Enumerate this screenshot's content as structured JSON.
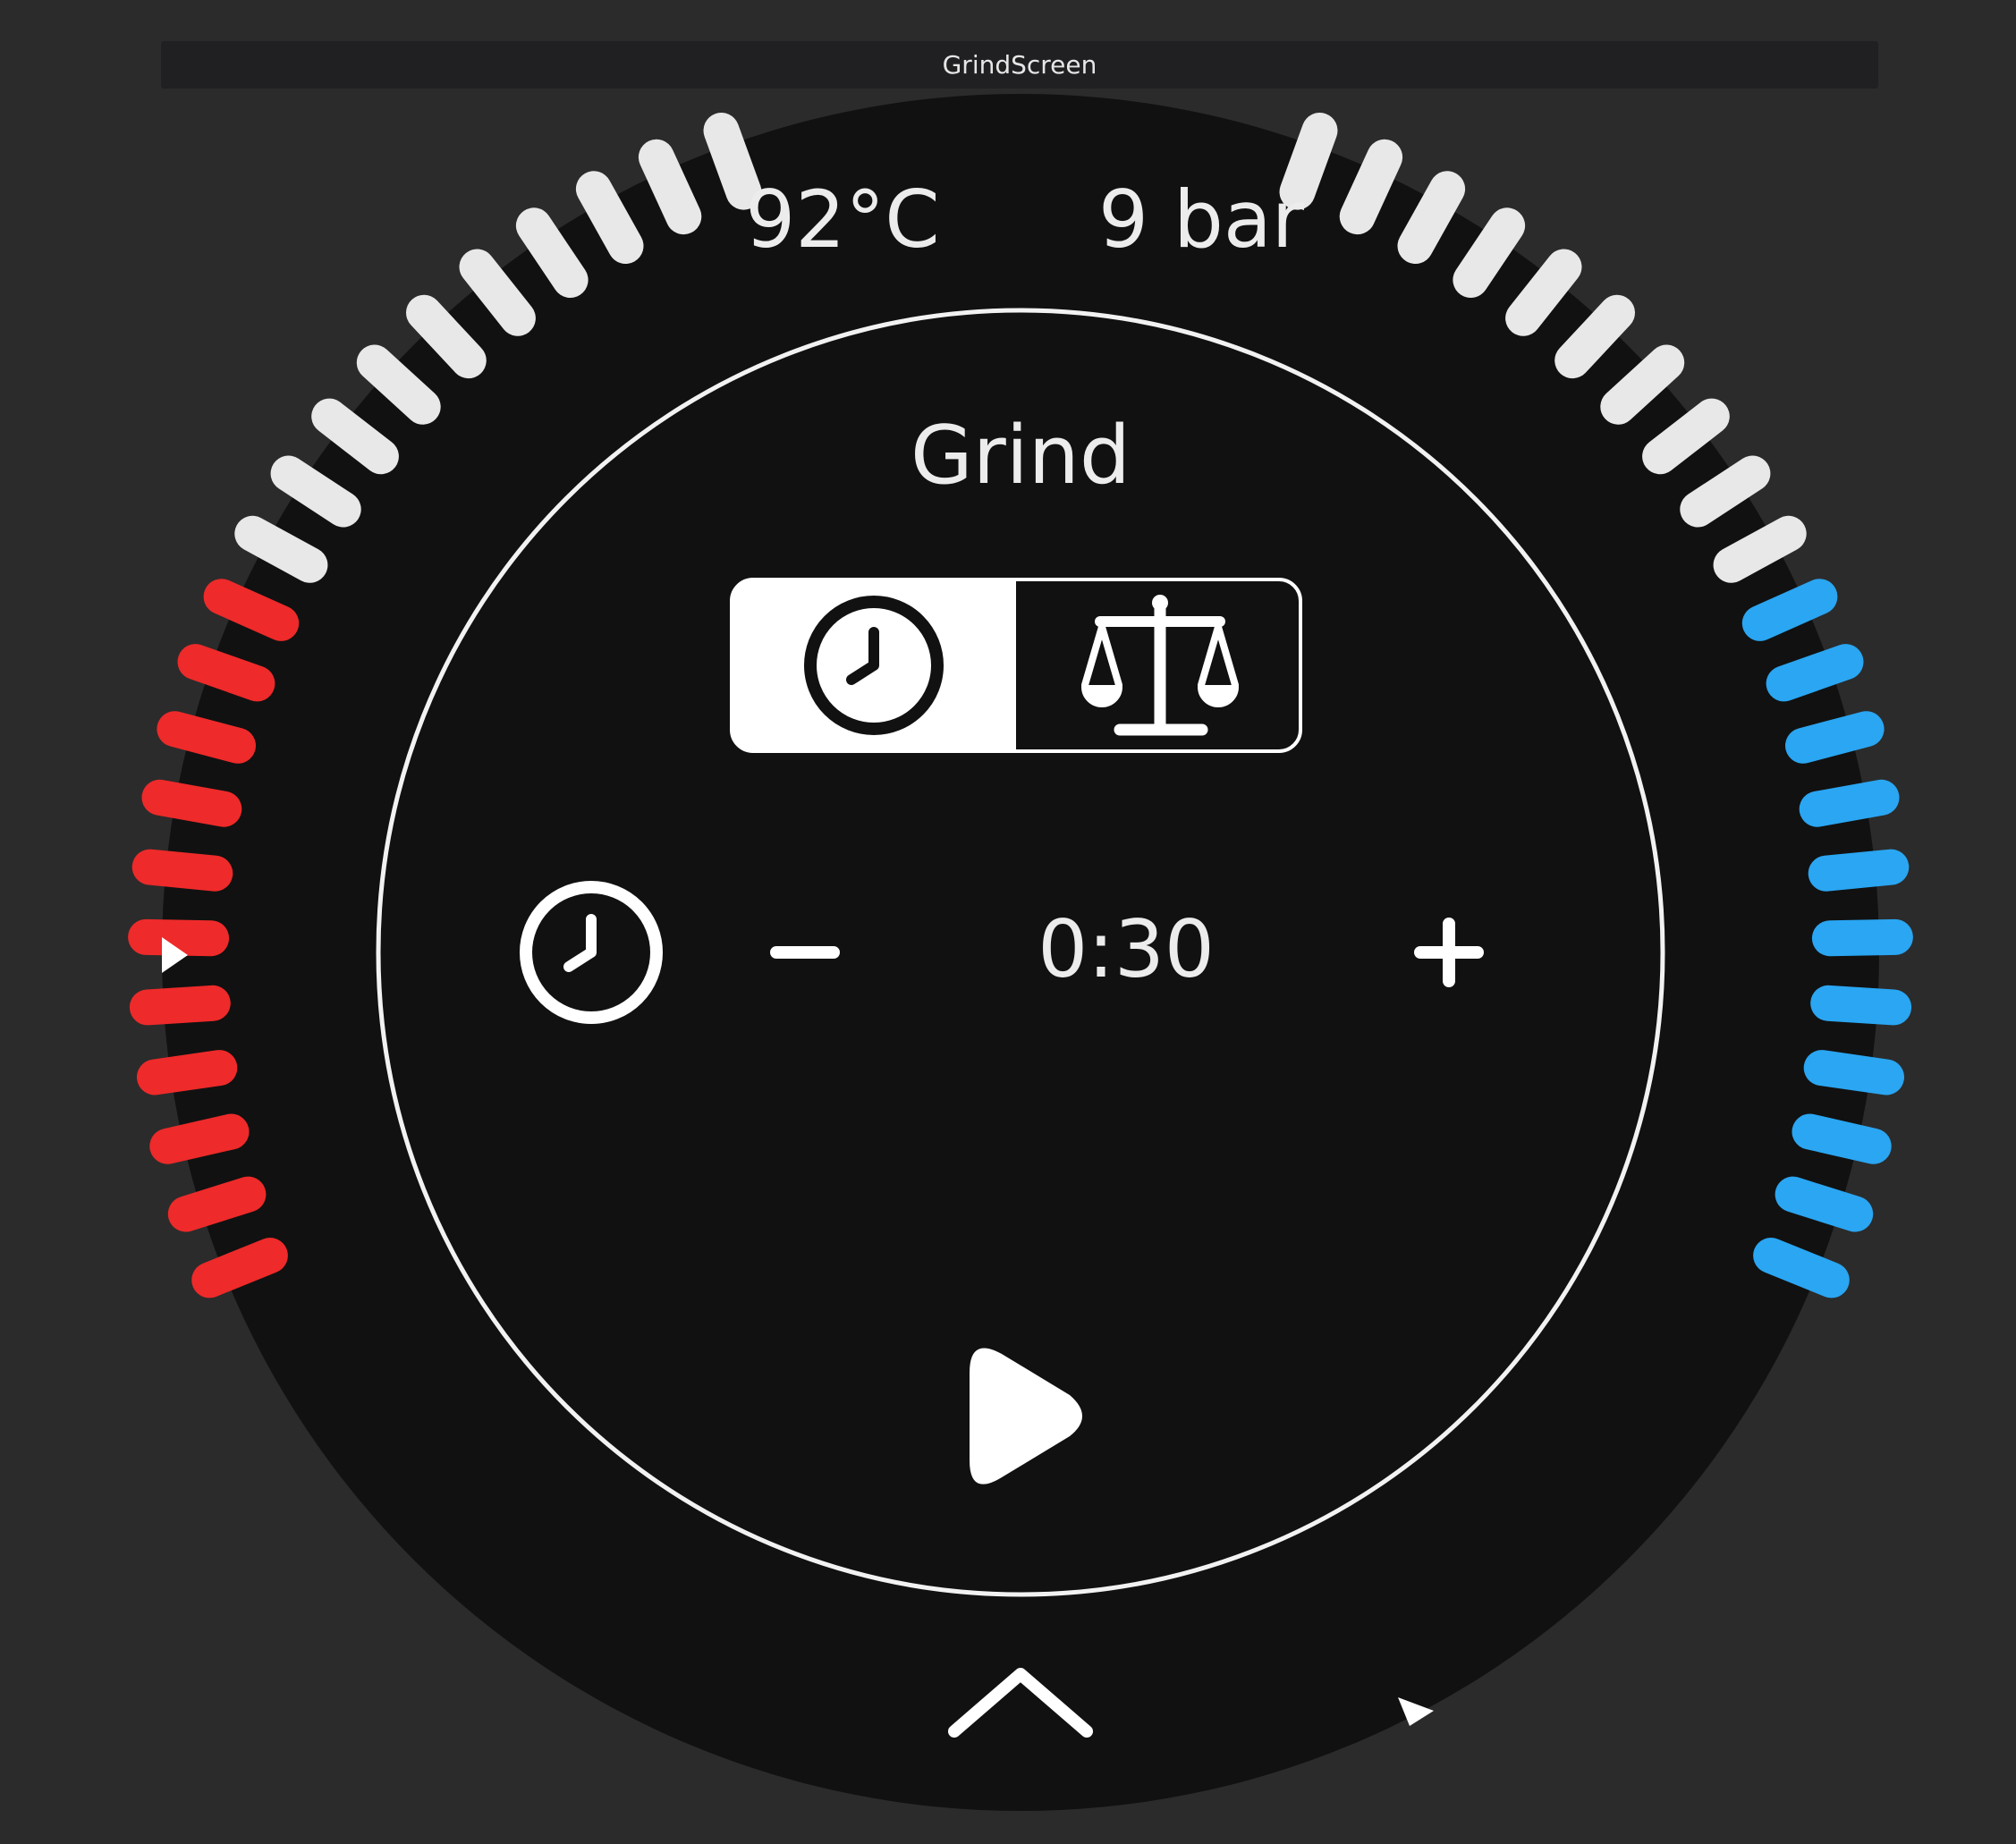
{
  "window": {
    "title": "GrindScreen"
  },
  "status": {
    "temperature": "92°C",
    "pressure": "9 bar"
  },
  "screen": {
    "title": "Grind",
    "time_value": "0:30"
  },
  "mode_toggle": {
    "options": [
      {
        "name": "time",
        "icon": "clock-icon"
      },
      {
        "name": "weight",
        "icon": "scale-icon"
      }
    ],
    "selected": "time"
  },
  "controls": {
    "decrement_icon": "minus-icon",
    "increment_icon": "plus-icon",
    "start_icon": "play-icon",
    "expand_icon": "chevron-up-icon",
    "mode_icon": "clock-icon"
  },
  "temperature_gauge": {
    "level": 0.52,
    "color": "#ee2a2a"
  },
  "pressure_gauge": {
    "level": 0.52,
    "color": "#2aa6f2"
  },
  "colors": {
    "background": "#2b2b2b",
    "dial": "#111111",
    "tick_inactive": "#e8e8e8",
    "foreground": "#ffffff"
  }
}
